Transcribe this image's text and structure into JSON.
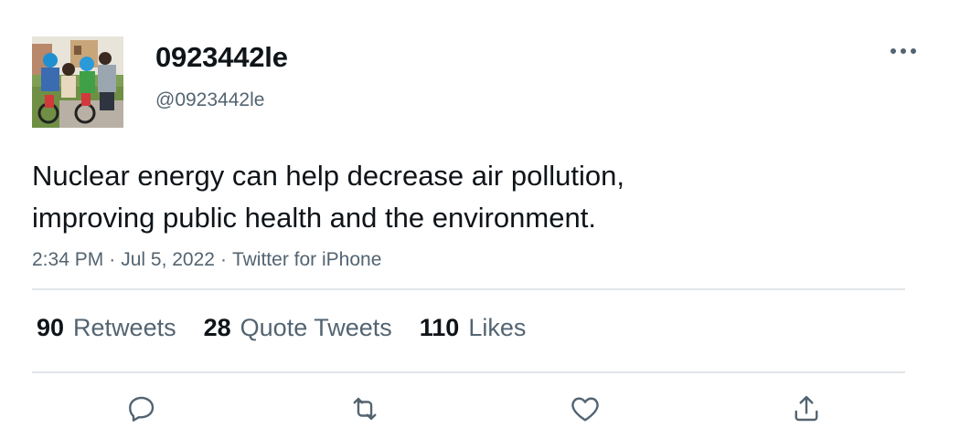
{
  "author": {
    "display_name": "0923442le",
    "handle": "@0923442le"
  },
  "tweet": {
    "text_lines": [
      "Nuclear energy can help decrease air pollution,",
      "improving public health and the environment."
    ],
    "time": "2:34 PM",
    "date": "Jul 5, 2022",
    "source": "Twitter for iPhone",
    "separator": "·"
  },
  "stats": {
    "retweets": {
      "count": "90",
      "label": "Retweets"
    },
    "quote_tweets": {
      "count": "28",
      "label": "Quote Tweets"
    },
    "likes": {
      "count": "110",
      "label": "Likes"
    }
  },
  "icons": {
    "more": "more-horizontal-icon",
    "reply": "reply-icon",
    "retweet": "retweet-icon",
    "like": "heart-icon",
    "share": "share-icon"
  },
  "colors": {
    "text_primary": "#0f1419",
    "text_secondary": "#536471",
    "divider": "#e1e5e9",
    "icon": "#536471"
  }
}
